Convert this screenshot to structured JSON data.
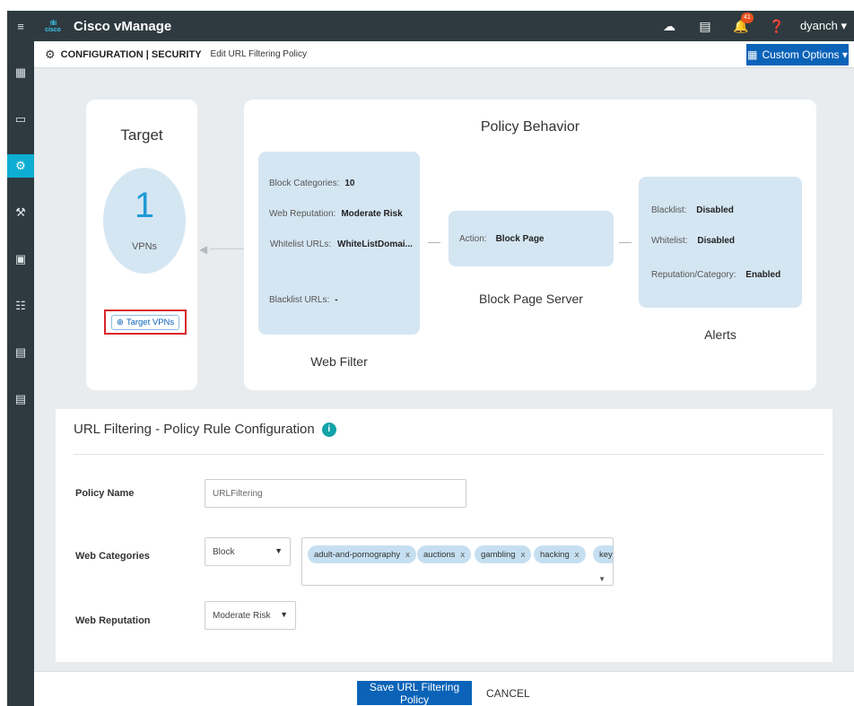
{
  "topbar": {
    "logo_text": "cisco",
    "app_title": "Cisco vManage",
    "icons": [
      "cloud-icon",
      "clipboard-icon",
      "bell-icon",
      "help-icon"
    ],
    "notification_count": "41",
    "user": "dyanch ▾"
  },
  "sidebar": {
    "items": [
      {
        "icon": "menu-icon",
        "glyph": "≡"
      },
      {
        "icon": "dashboard-icon",
        "glyph": "▦"
      },
      {
        "icon": "monitor-icon",
        "glyph": "▭"
      },
      {
        "icon": "configuration-icon",
        "glyph": "⚙",
        "active": true
      },
      {
        "icon": "tools-icon",
        "glyph": "⚒"
      },
      {
        "icon": "maintenance-icon",
        "glyph": "▣"
      },
      {
        "icon": "administration-icon",
        "glyph": "☷"
      },
      {
        "icon": "analytics-icon",
        "glyph": "▤"
      },
      {
        "icon": "reports-icon",
        "glyph": "▤"
      }
    ]
  },
  "breadcrumb": {
    "section": "CONFIGURATION | SECURITY",
    "page": "Edit URL Filtering Policy",
    "custom_options": "Custom Options ▾"
  },
  "target": {
    "title": "Target",
    "count": "1",
    "count_label": "VPNs",
    "button": "Target VPNs"
  },
  "policy_behavior": {
    "title": "Policy Behavior",
    "web_filter": {
      "label": "Web Filter",
      "rows": [
        {
          "key": "Block Categories:",
          "value": "10"
        },
        {
          "key": "Web Reputation:",
          "value": "Moderate Risk"
        },
        {
          "key": "Whitelist URLs:",
          "value": "WhiteListDomai..."
        },
        {
          "key": "Blacklist URLs:",
          "value": "-"
        }
      ]
    },
    "block_page": {
      "label": "Block Page Server",
      "key": "Action:",
      "value": "Block Page"
    },
    "alerts": {
      "label": "Alerts",
      "rows": [
        {
          "key": "Blacklist:",
          "value": "Disabled"
        },
        {
          "key": "Whitelist:",
          "value": "Disabled"
        },
        {
          "key": "Reputation/Category:",
          "value": "Enabled"
        }
      ]
    }
  },
  "config": {
    "title": "URL Filtering - Policy Rule Configuration",
    "info": "i",
    "policy_name_label": "Policy Name",
    "policy_name_value": "URLFiltering",
    "web_categories_label": "Web Categories",
    "web_categories_mode": "Block",
    "tags": [
      "adult-and-pornography",
      "auctions",
      "gambling",
      "hacking",
      "key"
    ],
    "web_reputation_label": "Web Reputation",
    "web_reputation_value": "Moderate Risk"
  },
  "footer": {
    "save": "Save URL Filtering Policy",
    "cancel": "CANCEL"
  },
  "colors": {
    "primary": "#0b63b8",
    "sidebar": "#2e3a40",
    "active": "#0eaed3",
    "card_fill": "#d5e6f3",
    "highlight": "#d9262a"
  }
}
